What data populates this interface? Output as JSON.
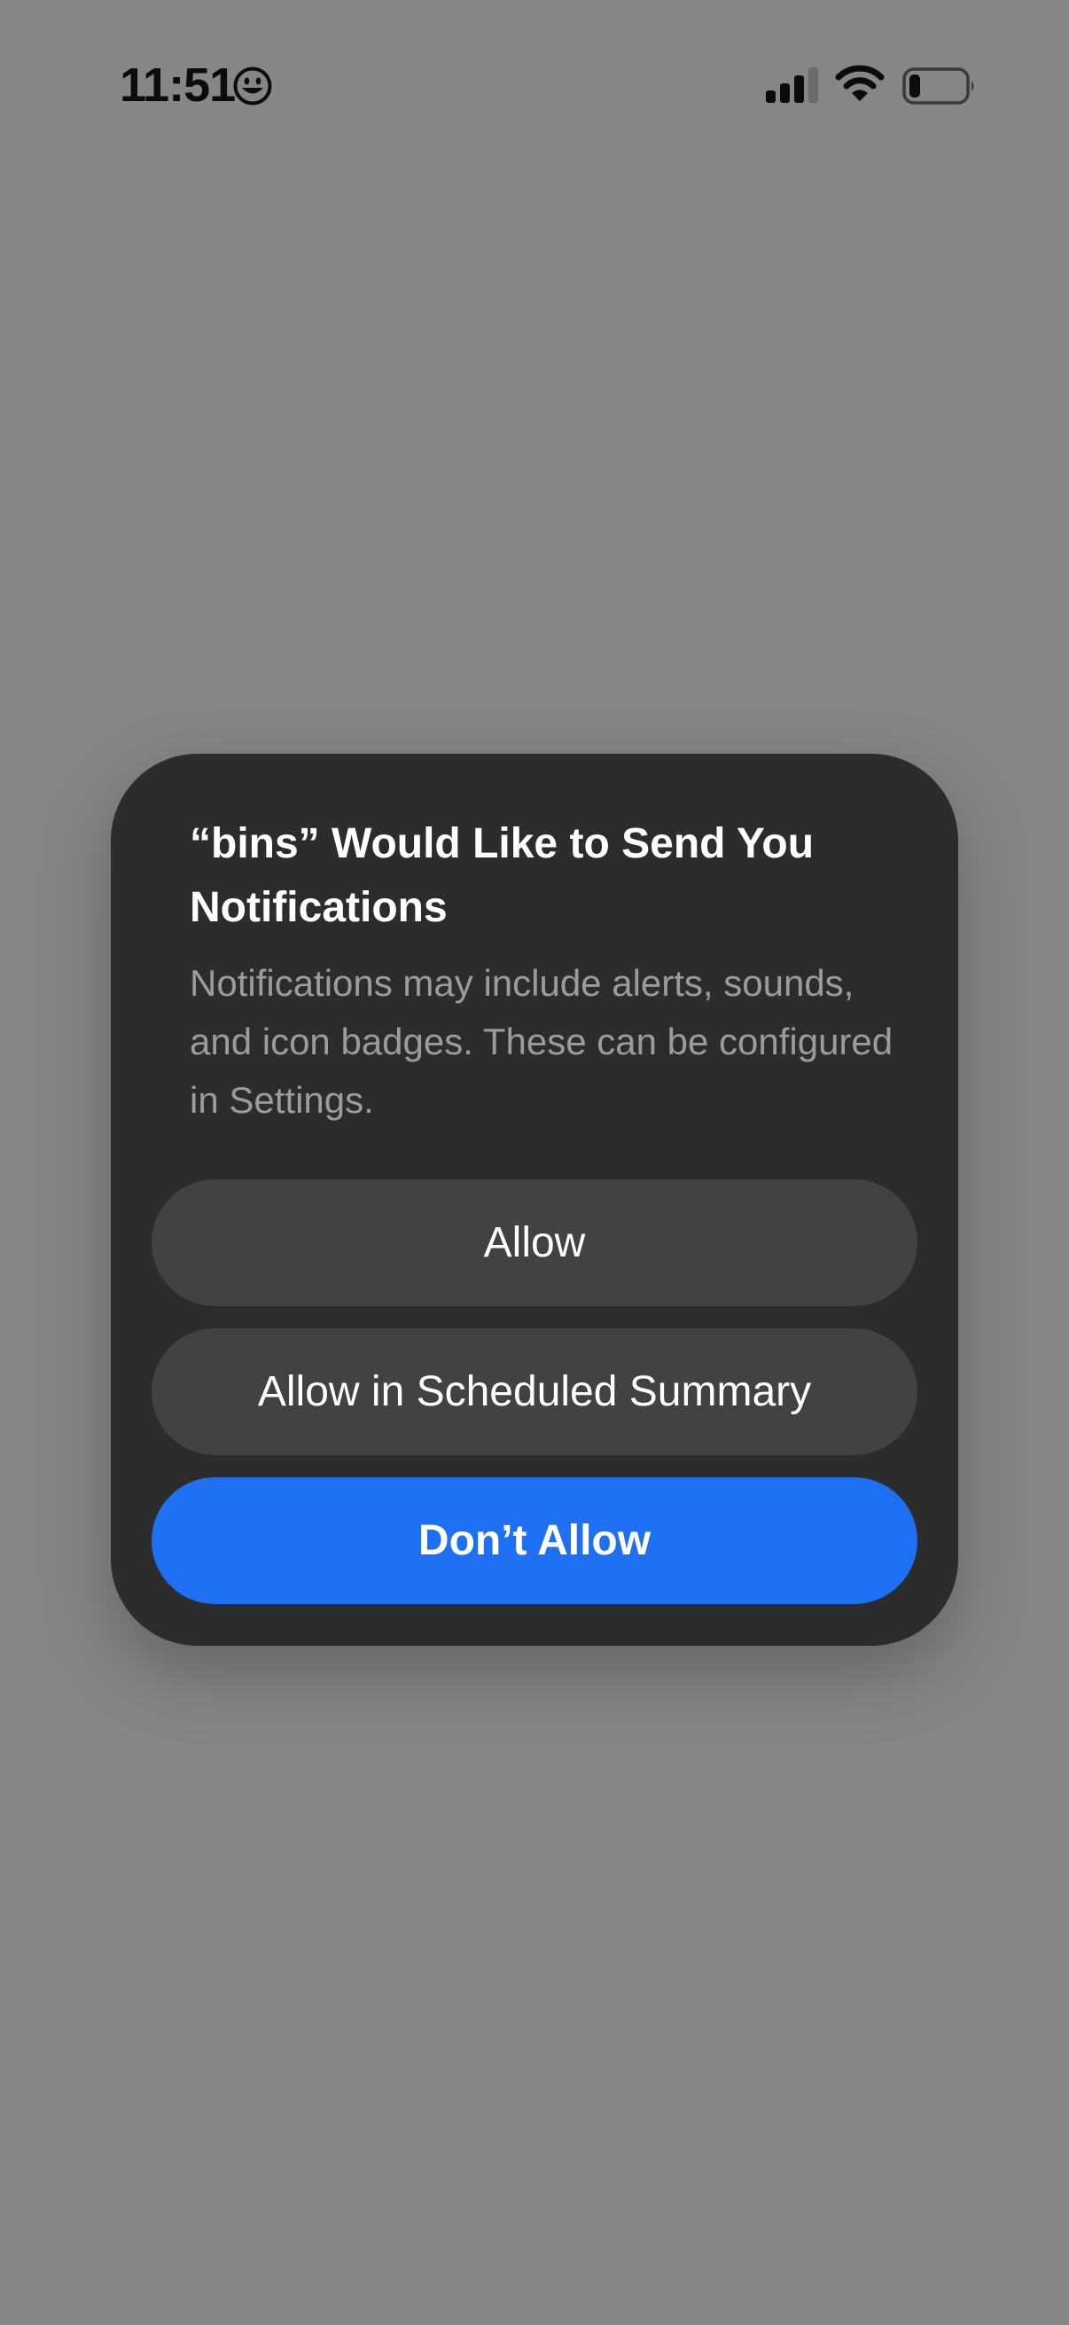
{
  "status_bar": {
    "time": "11:51",
    "icons": [
      "smiley-face-icon",
      "cellular-signal-icon",
      "wifi-icon",
      "battery-icon"
    ],
    "battery_level_fraction": 0.2
  },
  "dialog": {
    "title": "“bins” Would Like to Send You Notifications",
    "message": "Notifications may include alerts, sounds, and icon badges. These can be configured in Settings.",
    "buttons": {
      "allow": "Allow",
      "scheduled_summary": "Allow in Scheduled Summary",
      "dont_allow": "Don’t Allow"
    }
  },
  "colors": {
    "background_dim": "#868686",
    "dialog_background": "#2c2c2c",
    "secondary_button": "#424242",
    "primary_button": "#1f6ff2",
    "message_text": "#9c9c9c"
  }
}
